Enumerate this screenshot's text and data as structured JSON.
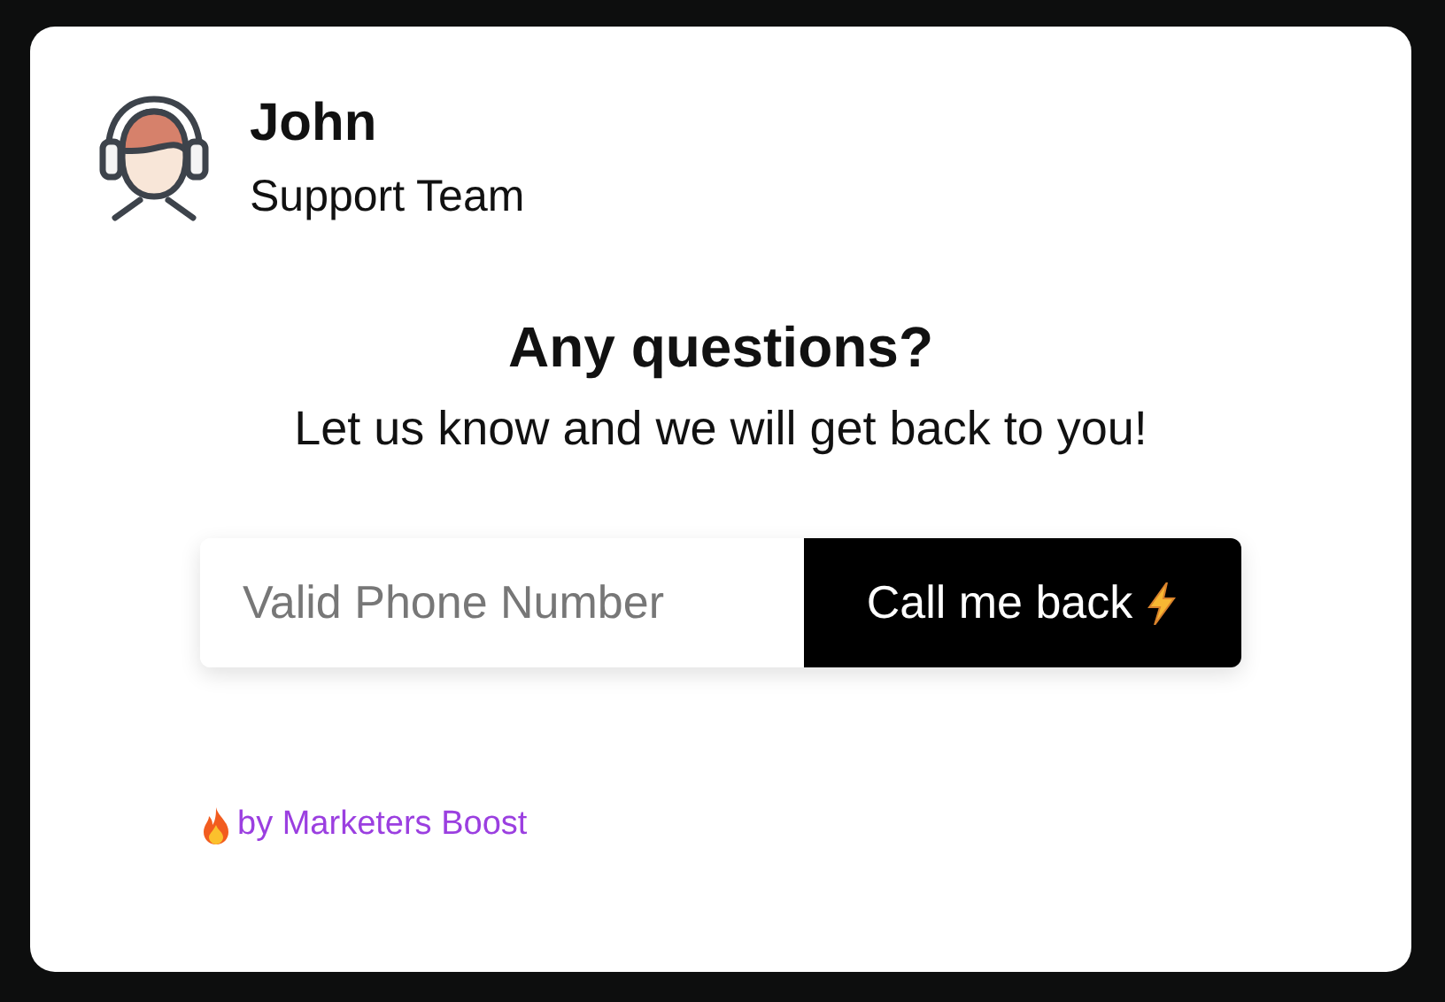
{
  "agent": {
    "name": "John",
    "team": "Support Team"
  },
  "heading": "Any questions?",
  "subheading": "Let us know and we will get back to you!",
  "phone_field": {
    "placeholder": "Valid Phone Number"
  },
  "call_button": {
    "label": "Call me back"
  },
  "footer": {
    "link": "by Marketers Boost"
  }
}
